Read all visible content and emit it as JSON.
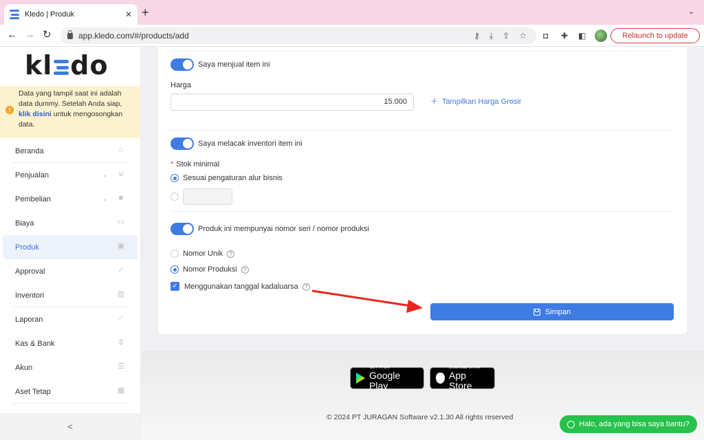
{
  "browser": {
    "tab_title": "Kledo | Produk",
    "tab_close": "✕",
    "new_tab": "+",
    "tab_menu": "⌄",
    "url": "app.kledo.com/#/products/add",
    "relaunch_label": "Relaunch to update"
  },
  "sidebar": {
    "logo_left": "kl",
    "logo_right": "do",
    "notice": {
      "text_before": "Data yang tampil saat ini adalah data dummy. Setelah Anda siap,",
      "link": "klik disini",
      "text_after": "untuk mengosongkan data."
    },
    "items": [
      {
        "label": "Beranda",
        "icon": "home-icon"
      },
      {
        "label": "Penjualan",
        "icon": "basket-icon"
      },
      {
        "label": "Pembelian",
        "icon": "bag-icon"
      },
      {
        "label": "Biaya",
        "icon": "card-icon"
      },
      {
        "label": "Produk",
        "icon": "box-icon"
      },
      {
        "label": "Approval",
        "icon": "check-icon"
      },
      {
        "label": "Inventori",
        "icon": "warehouse-icon"
      },
      {
        "label": "Laporan",
        "icon": "chart-icon"
      },
      {
        "label": "Kas & Bank",
        "icon": "dollar-icon"
      },
      {
        "label": "Akun",
        "icon": "list-icon"
      },
      {
        "label": "Aset Tetap",
        "icon": "building-icon"
      }
    ],
    "collapse": "<"
  },
  "form": {
    "sell_toggle_label": "Saya menjual item ini",
    "price_label": "Harga",
    "price_value": "15.000",
    "wholesale_link": "Tampilkan Harga Grosir",
    "inventory_toggle_label": "Saya melacak inventori item ini",
    "min_stock_label": "Stok minimal",
    "min_stock_option": "Sesuai pengaturan alur bisnis",
    "serial_toggle_label": "Produk ini mempunyai nomor seri / nomor produksi",
    "unique_number_label": "Nomor Unik",
    "production_number_label": "Nomor Produksi",
    "expiry_label": "Menggunakan tanggal kadaluarsa",
    "save_label": "Simpan"
  },
  "footer": {
    "google_play_small": "GET IT ON",
    "google_play_big": "Google Play",
    "app_store_small": "Download on the",
    "app_store_big": "App Store",
    "copyright": "© 2024 PT JURAGAN Software v2.1.30 All rights reserved",
    "whatsapp_label": "Halo, ada yang bisa saya bantu?"
  },
  "colors": {
    "accent": "#3e7be3",
    "annotation_arrow": "#e8261d",
    "whatsapp": "#27c24c",
    "notice_bg": "#fdf2cf"
  }
}
